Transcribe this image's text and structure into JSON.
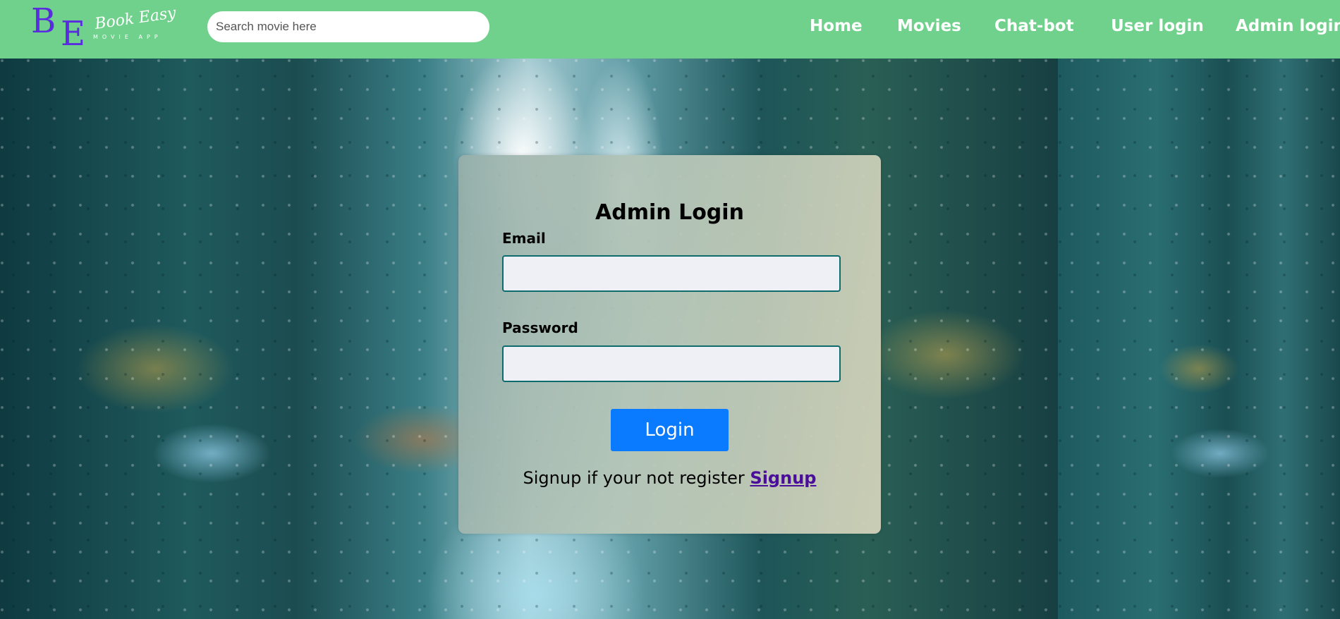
{
  "header": {
    "logo": {
      "initial_1": "B",
      "initial_2": "E",
      "script_text": "Book Easy",
      "subtitle": "MOVIE APP"
    },
    "search": {
      "placeholder": "Search movie here",
      "value": ""
    },
    "nav": {
      "home": "Home",
      "movies": "Movies",
      "chatbot": "Chat-bot",
      "user_login": "User login",
      "admin_login": "Admin login"
    }
  },
  "login": {
    "title": "Admin Login",
    "email_label": "Email",
    "email_value": "",
    "password_label": "Password",
    "password_value": "",
    "button_label": "Login",
    "signup_prompt": "Signup if your not register",
    "signup_link": "Signup"
  },
  "colors": {
    "header_bg": "#6fd18b",
    "logo_accent": "#5a2be0",
    "button_bg": "#0a7bff",
    "input_border": "#0d6b6b",
    "link": "#4b0e9a"
  }
}
